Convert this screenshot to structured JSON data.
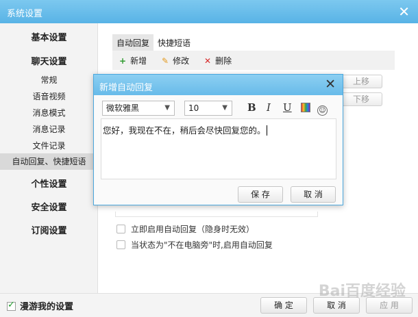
{
  "window": {
    "title": "系统设置"
  },
  "sidebar": {
    "items": [
      {
        "label": "基本设置"
      },
      {
        "label": "聊天设置"
      },
      {
        "label": "常规"
      },
      {
        "label": "语音视频"
      },
      {
        "label": "消息模式"
      },
      {
        "label": "消息记录"
      },
      {
        "label": "文件记录"
      },
      {
        "label": "自动回复、快捷短语"
      },
      {
        "label": "个性设置"
      },
      {
        "label": "安全设置"
      },
      {
        "label": "订阅设置"
      }
    ]
  },
  "main": {
    "tabs": [
      {
        "label": "自动回复"
      },
      {
        "label": "快捷短语"
      }
    ],
    "toolbar": {
      "add": "新增",
      "edit": "修改",
      "delete": "删除"
    },
    "side_buttons": {
      "up": "上移",
      "down": "下移"
    },
    "options": [
      {
        "label": "立即启用自动回复（隐身时无效）"
      },
      {
        "label": "当状态为\"不在电脑旁\"时,启用自动回复"
      }
    ]
  },
  "dialog": {
    "title": "新增自动回复",
    "font": "微软雅黑",
    "size": "10",
    "formats": {
      "bold": "B",
      "italic": "I",
      "underline": "U",
      "emoji": "☺"
    },
    "text": "您好，我现在不在，稍后会尽快回复您的。",
    "save": "保 存",
    "cancel": "取 消"
  },
  "bottom": {
    "roam": "漫游我的设置",
    "ok": "确 定",
    "cancel": "取 消",
    "apply": "应 用"
  },
  "colors": {
    "accent": "#58b3e6",
    "selected": "#d9d9d9",
    "add": "#2e9a2e",
    "edit": "#e39a1f",
    "delete": "#d62a2a"
  },
  "watermark": "Bai百度经验"
}
